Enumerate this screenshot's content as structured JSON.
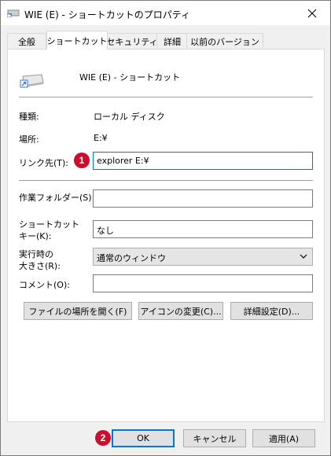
{
  "window": {
    "title": "WIE (E) - ショートカットのプロパティ",
    "close_glyph": "✕"
  },
  "tabs": [
    {
      "label": "全般"
    },
    {
      "label": "ショートカット"
    },
    {
      "label": "セキュリティ"
    },
    {
      "label": "詳細"
    },
    {
      "label": "以前のバージョン"
    }
  ],
  "shortcut": {
    "name": "WIE (E) - ショートカット",
    "type_label": "種類:",
    "type_value": "ローカル ディスク",
    "location_label": "場所:",
    "location_value": "E:¥",
    "target_label": "リンク先(T):",
    "target_value": "explorer E:¥",
    "start_in_label": "作業フォルダー(S):",
    "start_in_value": "",
    "hotkey_label_1": "ショートカット",
    "hotkey_label_2": "キー(K):",
    "hotkey_value": "なし",
    "run_label_1": "実行時の",
    "run_label_2": "大きさ(R):",
    "run_value": "通常のウィンドウ",
    "comment_label": "コメント(O):",
    "comment_value": ""
  },
  "buttons": {
    "open_location": "ファイルの場所を開く(F)",
    "change_icon": "アイコンの変更(C)...",
    "advanced": "詳細設定(D)...",
    "ok": "OK",
    "cancel": "キャンセル",
    "apply": "適用(A)"
  },
  "annotations": {
    "badge1": "1",
    "badge2": "2"
  },
  "colors": {
    "badge": "#c8102e",
    "focus": "#0078d7"
  }
}
